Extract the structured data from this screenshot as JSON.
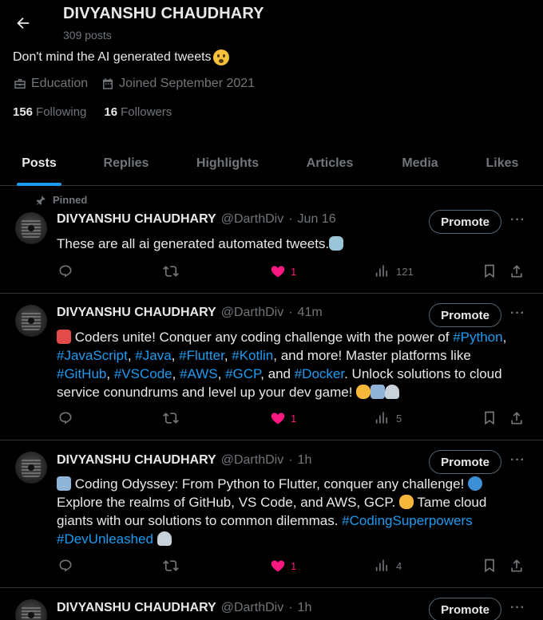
{
  "header": {
    "name": "DIVYANSHU CHAUDHARY",
    "post_count": "309 posts"
  },
  "profile": {
    "bio": "Don't mind the AI generated tweets",
    "category": "Education",
    "joined": "Joined September 2021",
    "following_count": "156",
    "following_label": "Following",
    "followers_count": "16",
    "followers_label": "Followers"
  },
  "tabs": [
    "Posts",
    "Replies",
    "Highlights",
    "Articles",
    "Media",
    "Likes"
  ],
  "pinned_label": "Pinned",
  "promote_label": "Promote",
  "tweets": [
    {
      "name": "DIVYANSHU CHAUDHARY",
      "handle": "@DarthDiv",
      "sep": "·",
      "time": "Jun 16",
      "text": "These are all ai generated automated  tweets.",
      "likes": "1",
      "views": "121"
    },
    {
      "name": "DIVYANSHU CHAUDHARY",
      "handle": "@DarthDiv",
      "sep": "·",
      "time": "41m",
      "text_parts": [
        " Coders unite! Conquer any coding challenge with the power of ",
        "#Python",
        ",",
        "#JavaScript",
        ", ",
        "#Java",
        ", ",
        "#Flutter",
        ", ",
        "#Kotlin",
        ", and more! Master platforms like",
        "#GitHub",
        ", ",
        "#VSCode",
        ", ",
        "#AWS",
        ", ",
        "#GCP",
        ", and ",
        "#Docker",
        ". Unlock solutions to cloud",
        "service conundrums and level up your dev game! "
      ],
      "likes": "1",
      "views": "5"
    },
    {
      "name": "DIVYANSHU CHAUDHARY",
      "handle": "@DarthDiv",
      "sep": "·",
      "time": "1h",
      "text_parts": [
        " Coding Odyssey: From Python to Flutter, conquer any challenge! ",
        "Explore the realms of GitHub, VS Code, and AWS, GCP. ",
        " Tame cloud",
        "giants with our solutions to common dilemmas. ",
        "#CodingSuperpowers",
        "#DevUnleashed"
      ],
      "likes": "1",
      "views": "4"
    },
    {
      "name": "DIVYANSHU CHAUDHARY",
      "handle": "@DarthDiv",
      "sep": "·",
      "time": "1h"
    }
  ],
  "colors": {
    "background": "#000000",
    "accent": "#1d9bf0",
    "like": "#f91880",
    "muted": "#71767b",
    "text": "#e7e9ea",
    "border": "#2f3336"
  }
}
